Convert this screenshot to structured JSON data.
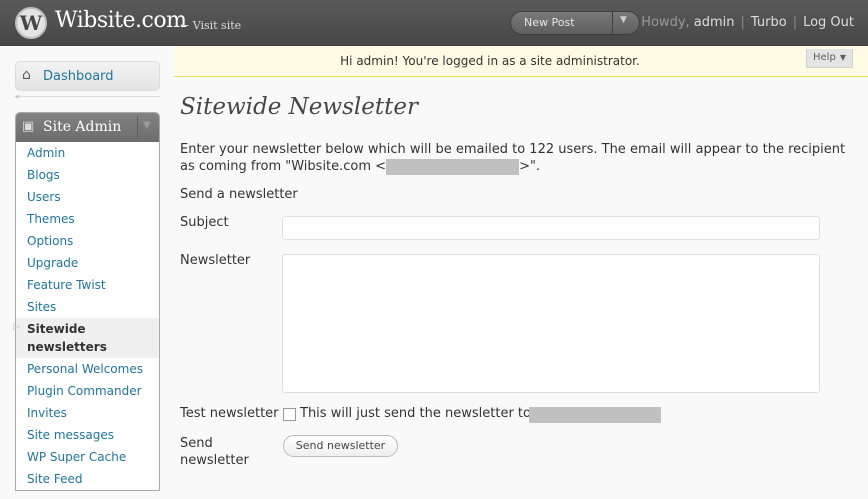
{
  "header": {
    "logo": "W",
    "site_title": "Wibsite.com",
    "visit_site": "← Visit site",
    "new_post": "New Post",
    "howdy": "Howdy,",
    "user": "admin",
    "turbo": "Turbo",
    "logout": "Log Out"
  },
  "notice": {
    "text": "Hi admin! You're logged in as a site administrator.",
    "help": "Help"
  },
  "sidebar": {
    "dashboard": "Dashboard",
    "site_admin": "Site Admin",
    "items": [
      {
        "label": "Admin"
      },
      {
        "label": "Blogs"
      },
      {
        "label": "Users"
      },
      {
        "label": "Themes"
      },
      {
        "label": "Options"
      },
      {
        "label": "Upgrade"
      },
      {
        "label": "Feature Twist"
      },
      {
        "label": "Sites"
      },
      {
        "label": "Sitewide newsletters",
        "current": true
      },
      {
        "label": "Personal Welcomes"
      },
      {
        "label": "Plugin Commander"
      },
      {
        "label": "Invites"
      },
      {
        "label": "Site messages"
      },
      {
        "label": "WP Super Cache"
      },
      {
        "label": "Site Feed"
      }
    ]
  },
  "main": {
    "title": "Sitewide Newsletter",
    "intro_part1": "Enter your newsletter below which will be emailed to 122 users. The email will appear to the recipient as coming from \"Wibsite.com <",
    "intro_part2": ">\".",
    "send_heading": "Send a newsletter",
    "subject_label": "Subject",
    "subject_value": "",
    "newsletter_label": "Newsletter",
    "newsletter_value": "",
    "test_label": "Test newsletter",
    "test_checked": false,
    "test_text": "This will just send the newsletter to",
    "send_label": "Send newsletter",
    "send_button": "Send newsletter"
  },
  "colors": {
    "header_bg": "#464646",
    "link": "#21759b",
    "notice_bg": "#fffbe4",
    "redaction": "#c0c0c0"
  },
  "icons": [
    "wordpress-logo-icon",
    "dashboard-house-icon",
    "site-admin-icon",
    "dropdown-arrow-icon",
    "collapse-arrow-icon"
  ]
}
